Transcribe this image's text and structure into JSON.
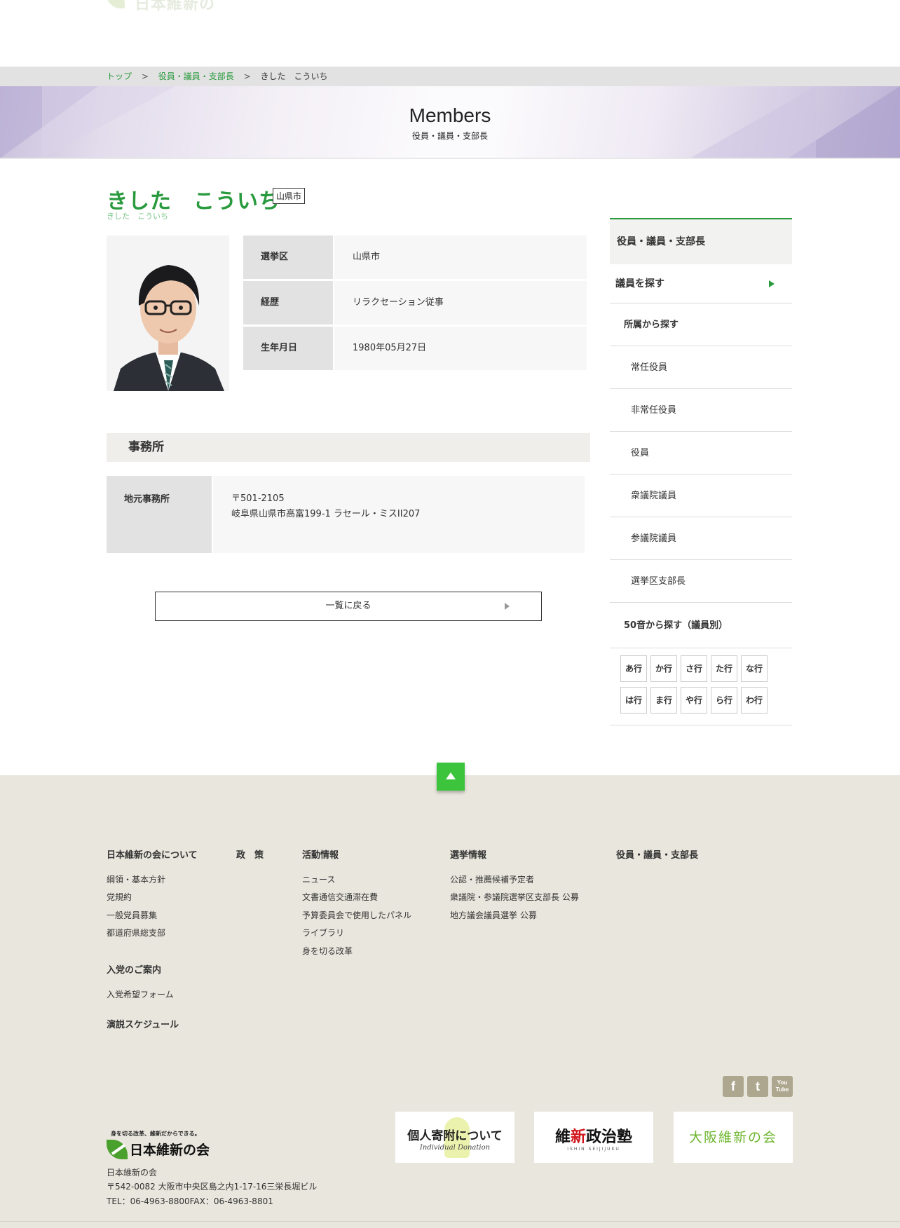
{
  "header": {
    "logo_text": "日本維新の会"
  },
  "breadcrumb": {
    "items": [
      "トップ",
      "役員・議員・支部長"
    ],
    "separator": ">",
    "current": "きした　こういち"
  },
  "hero": {
    "title": "Members",
    "subtitle": "役員・議員・支部長"
  },
  "member": {
    "name": "きした　こういち",
    "kana": "きした　こういち",
    "area_tag": "山県市",
    "photo_icon": "portrait-photo",
    "info": [
      {
        "label": "選挙区",
        "value": "山県市"
      },
      {
        "label": "経歴",
        "value": "リラクセーション従事"
      },
      {
        "label": "生年月日",
        "value": "1980年05月27日"
      }
    ]
  },
  "office": {
    "heading": "事務所",
    "label": "地元事務所",
    "postal": "〒501-2105",
    "address": "岐阜県山県市高富199-1 ラセール・ミスII207"
  },
  "back_button": {
    "label": "一覧に戻る"
  },
  "sidebar": {
    "heading": "役員・議員・支部長",
    "find_members": "議員を探す",
    "by_affiliation": "所属から探す",
    "affiliation_items": [
      "常任役員",
      "非常任役員",
      "役員",
      "衆議院議員",
      "参議院議員",
      "選挙区支部長"
    ],
    "by_kana": "50音から探す（議員別）",
    "kana_rows": [
      "あ行",
      "か行",
      "さ行",
      "た行",
      "な行",
      "は行",
      "ま行",
      "や行",
      "ら行",
      "わ行"
    ]
  },
  "page_top": {
    "icon": "arrow-up-icon"
  },
  "footer": {
    "col_about": {
      "heading": "日本維新の会について",
      "links": [
        "綱領・基本方針",
        "党規約",
        "一般党員募集",
        "都道府県総支部"
      ]
    },
    "col_join": {
      "heading": "入党のご案内",
      "links": [
        "入党希望フォーム"
      ]
    },
    "col_speech": {
      "heading": "演説スケジュール"
    },
    "col_policy": {
      "heading": "政　策"
    },
    "col_activity": {
      "heading": "活動情報",
      "links": [
        "ニュース",
        "文書通信交通滞在費",
        "予算委員会で使用したパネル",
        "ライブラリ",
        "身を切る改革"
      ]
    },
    "col_election": {
      "heading": "選挙情報",
      "links": [
        "公認・推薦候補予定者",
        "衆議院・参議院選挙区支部長 公募",
        "地方議会議員選挙 公募"
      ]
    },
    "col_members": {
      "heading": "役員・議員・支部長"
    },
    "social": {
      "facebook": "f",
      "twitter": "t",
      "youtube": "You Tube"
    },
    "banners": {
      "donation_main": "個人寄附について",
      "donation_sub": "Individual Donation",
      "juku_main_a": "維",
      "juku_main_b": "新",
      "juku_main_c": "政治塾",
      "juku_sub": "ISHIN SEIJIJUKU",
      "osaka_main": "大阪維新の会"
    },
    "logo": {
      "tagline": "身を切る改革、維新だからできる。",
      "name": "日本維新の会"
    },
    "org_name": "日本維新の会",
    "address": "〒542-0082 大阪市中央区島之内1-17-16三栄長堀ビル",
    "contact": "TEL：06-4963-8800FAX：06-4963-8801"
  }
}
